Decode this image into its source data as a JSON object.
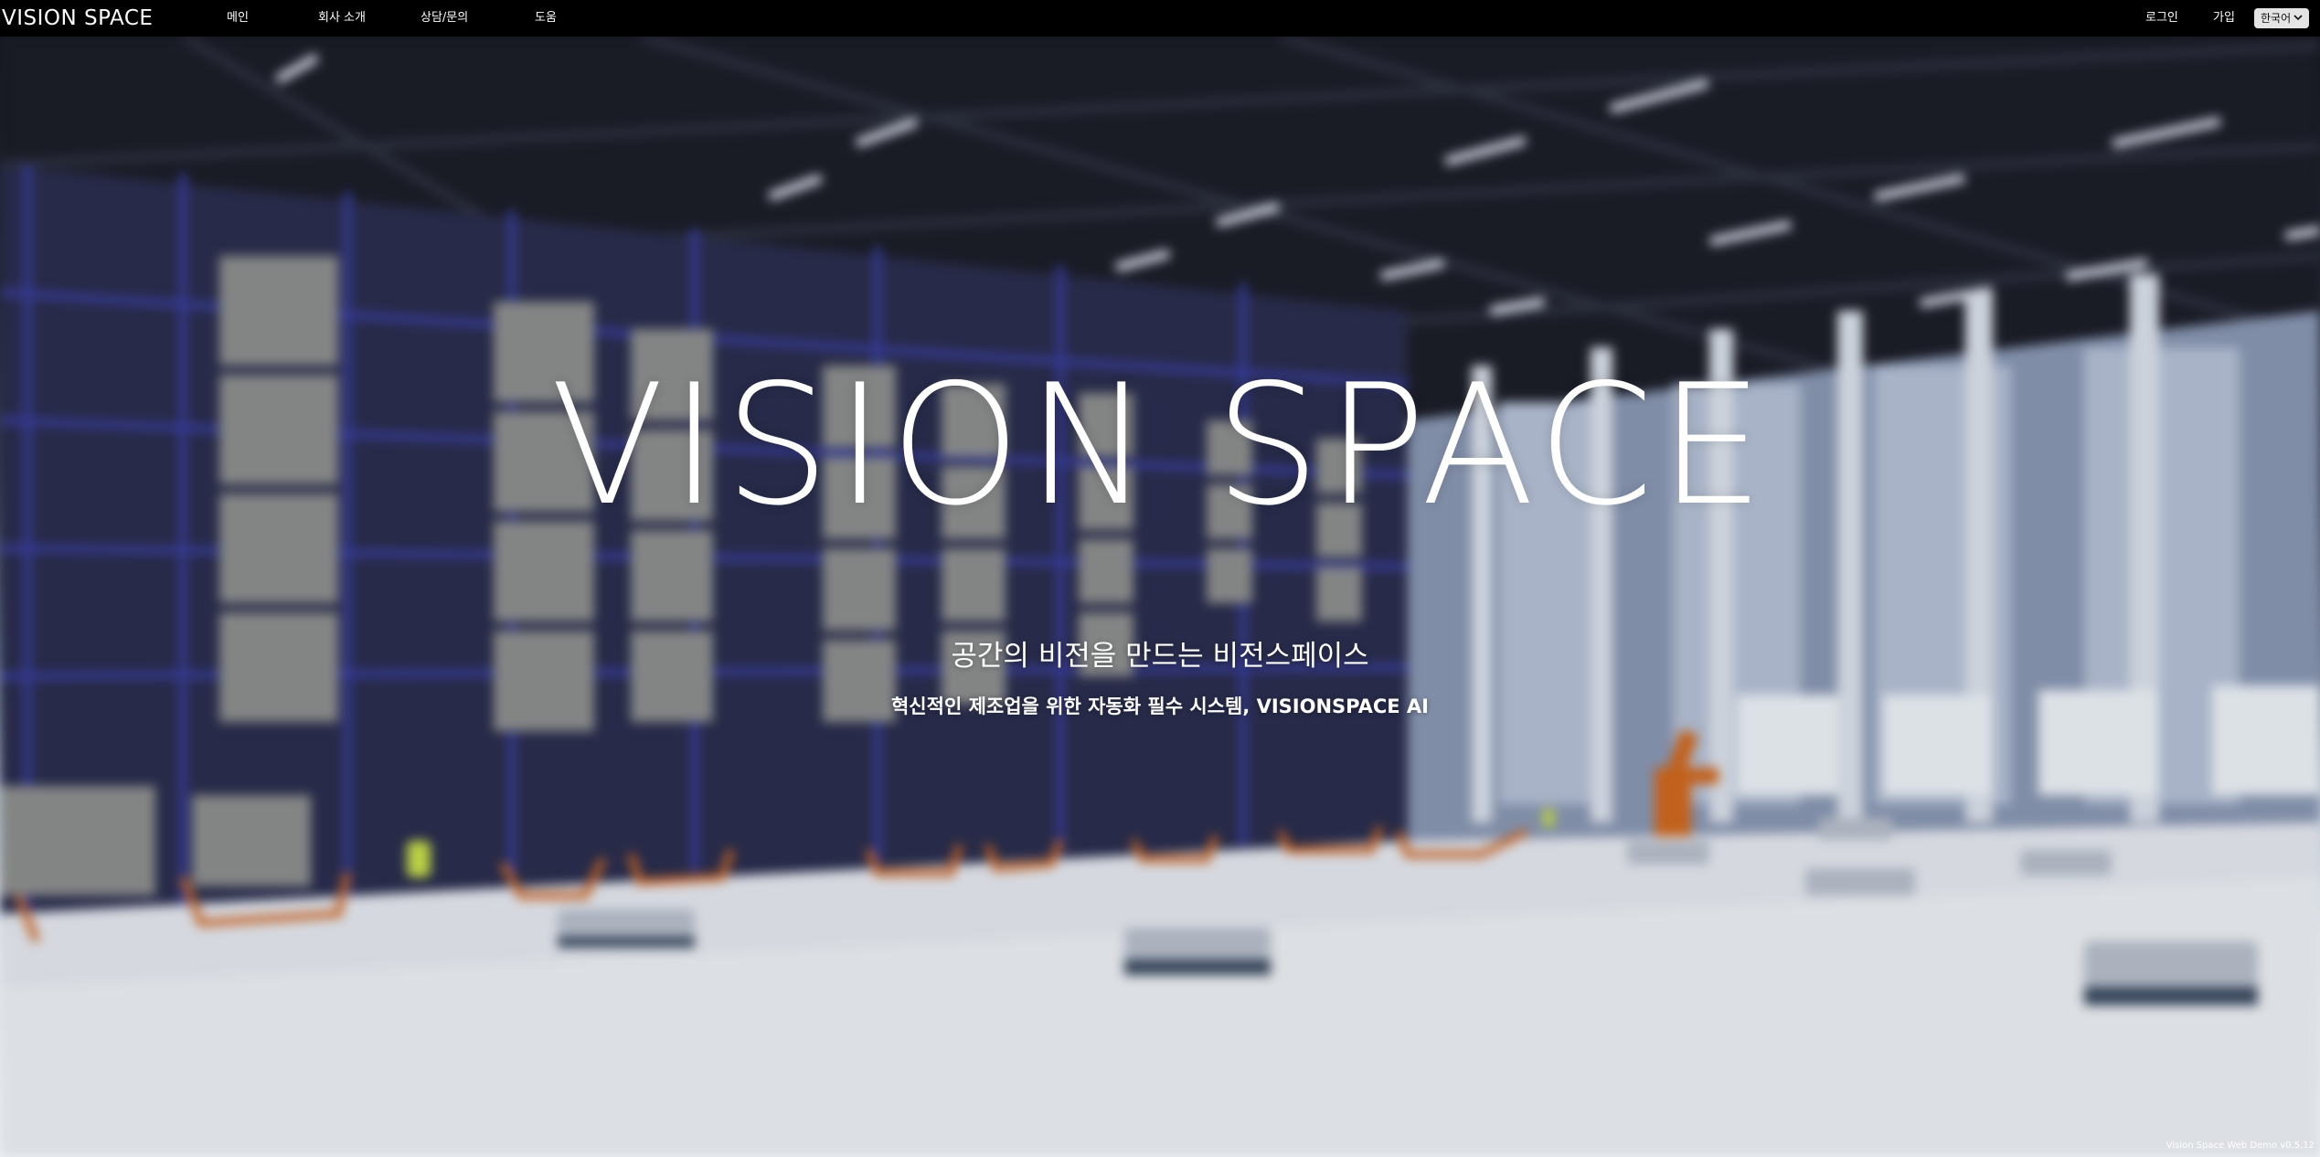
{
  "header": {
    "logo": "VISION SPACE",
    "nav": [
      {
        "label": "메인"
      },
      {
        "label": "회사 소개"
      },
      {
        "label": "상담/문의"
      },
      {
        "label": "도움"
      }
    ],
    "login_label": "로그인",
    "signup_label": "가입",
    "language": {
      "selected": "한국어"
    }
  },
  "hero": {
    "title": "VISION SPACE",
    "subtitle": "공간의 비전을 만드는 비전스페이스",
    "tagline": "혁신적인 제조업을 위한 자동화 필수 시스템, VISIONSPACE AI"
  },
  "footer": {
    "version": "Vision Space Web Demo v0.5.12"
  }
}
